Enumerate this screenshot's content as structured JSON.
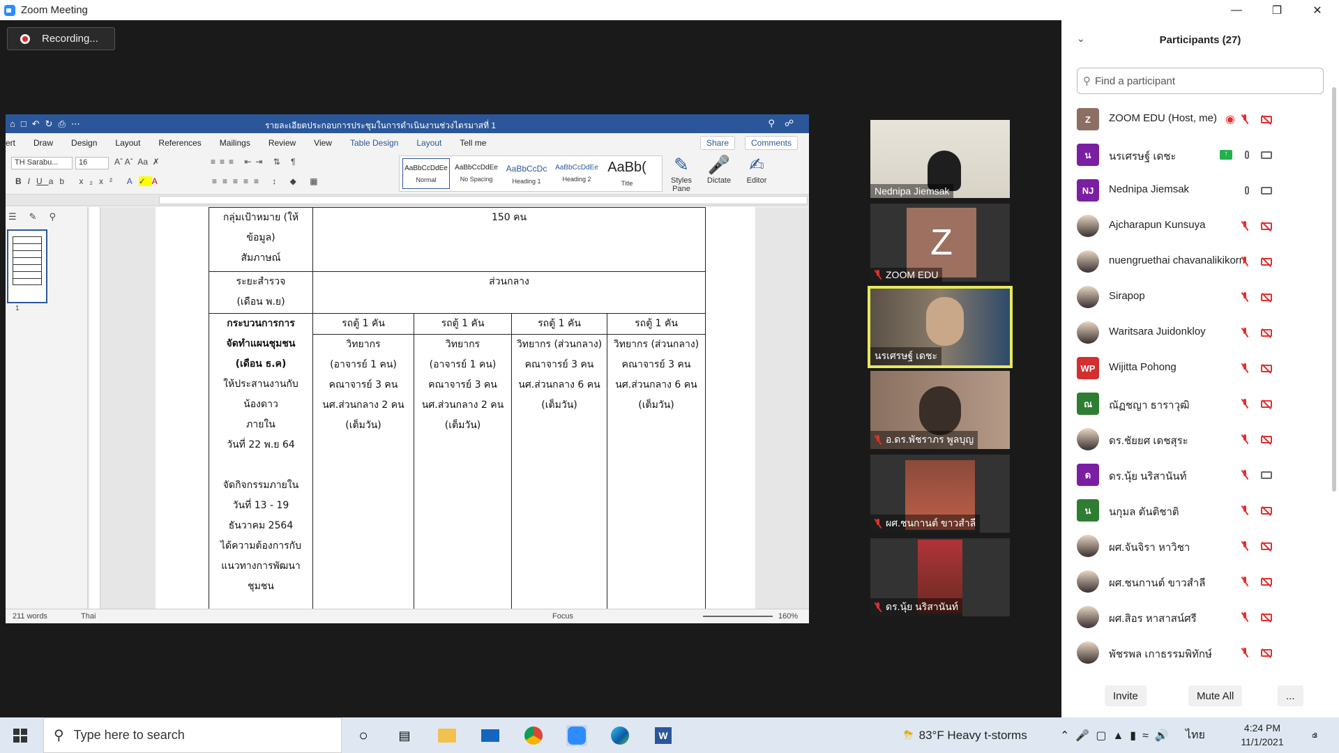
{
  "window": {
    "title": "Zoom Meeting"
  },
  "recording": {
    "label": "Recording..."
  },
  "word": {
    "doc_title": "รายละเอียดประกอบการประชุมในการดำเนินงานช่วงไตรมาสที่ 1",
    "menu": [
      "ert",
      "Draw",
      "Design",
      "Layout",
      "References",
      "Mailings",
      "Review",
      "View",
      "Table Design",
      "Layout",
      "Tell me"
    ],
    "share_label": "Share",
    "comments_label": "Comments",
    "font_name": "TH Sarabu...",
    "font_size": "16",
    "styles": [
      {
        "preview": "AaBbCcDdEe",
        "name": "Normal"
      },
      {
        "preview": "AaBbCcDdEe",
        "name": "No Spacing"
      },
      {
        "preview": "AaBbCcDc",
        "name": "Heading 1"
      },
      {
        "preview": "AaBbCcDdEe",
        "name": "Heading 2"
      },
      {
        "preview": "AaBb(",
        "name": "Title"
      }
    ],
    "styles_pane": "Styles Pane",
    "dictate": "Dictate",
    "editor": "Editor",
    "thumb_page": "1",
    "status": {
      "words": "211 words",
      "lang": "Thai",
      "focus": "Focus",
      "zoom": "160%"
    }
  },
  "table": {
    "r1_label": [
      "กลุ่มเป้าหมาย (ให้",
      "ข้อมูล)",
      "สัมภาษณ์"
    ],
    "r1_value": "150 คน",
    "r2_label": [
      "ระยะสำรวจ",
      "(เดือน พ.ย)"
    ],
    "r2_value": "ส่วนกลาง",
    "r3_label": [
      "กระบวนการการ",
      "จัดทำแผนชุมชน",
      "(เดือน ธ.ค)"
    ],
    "r3_head": [
      "รถตู้ 1 คัน",
      "รถตู้ 1 คัน",
      "รถตู้ 1 คัน",
      "รถตู้ 1 คัน"
    ],
    "r4_label": [
      "ให้ประสานงานกับ",
      "น้องดาว",
      "ภายใน",
      "วันที่ 22 พ.ย 64",
      "",
      "จัดกิจกรรมภายใน",
      "วันที่ 13 - 19",
      "ธันวาคม 2564",
      "ได้ความต้องการกับ",
      "แนวทางการพัฒนา",
      "ชุมชน"
    ],
    "c1": [
      "วิทยากร",
      "(อาจารย์ 1 คน)",
      "คณาจารย์ 3 คน",
      "นศ.ส่วนกลาง 2 คน",
      "(เต็มวัน)"
    ],
    "c2": [
      "วิทยากร",
      "(อาจารย์ 1 คน)",
      "คณาจารย์ 3 คน",
      "นศ.ส่วนกลาง 2 คน",
      "(เต็มวัน)"
    ],
    "c3": [
      "วิทยากร (ส่วนกลาง)",
      "คณาจารย์ 3 คน",
      "นศ.ส่วนกลาง 6 คน",
      "(เต็มวัน)"
    ],
    "c4": [
      "วิทยากร (ส่วนกลาง)",
      "คณาจารย์ 3 คน",
      "นศ.ส่วนกลาง 6 คน",
      "(เต็มวัน)"
    ]
  },
  "videos": [
    {
      "name": "Nednipa Jiemsak",
      "muted": false
    },
    {
      "name": "ZOOM EDU",
      "muted": true,
      "letter": "Z"
    },
    {
      "name": "นรเศรษฐ์ เดชะ",
      "muted": false,
      "active": true
    },
    {
      "name": "อ.ดร.พัชราภร พูลบุญ",
      "muted": true
    },
    {
      "name": "ผศ.ชนกานต์ ขาวสำลี",
      "muted": true
    },
    {
      "name": "ดร.นุ้ย นริสานันท์",
      "muted": true
    }
  ],
  "participants": {
    "title": "Participants (27)",
    "search_placeholder": "Find a participant",
    "list": [
      {
        "name": "ZOOM EDU (Host, me)",
        "initial": "Z",
        "color": "#8d6e63",
        "rec": true
      },
      {
        "name": "นรเศรษฐ์ เดชะ",
        "initial": "น",
        "color": "#7b1fa2",
        "share": true,
        "mic_on": true
      },
      {
        "name": "Nednipa Jiemsak",
        "initial": "NJ",
        "color": "#7b1fa2",
        "mic_on": true
      },
      {
        "name": "Ajcharapun Kunsuya",
        "photo": true
      },
      {
        "name": "nuengruethai chavanalikikorn",
        "photo": true
      },
      {
        "name": "Sirapop",
        "photo": true
      },
      {
        "name": "Waritsara Juidonkloy",
        "photo": true
      },
      {
        "name": "Wijitta Pohong",
        "initial": "WP",
        "color": "#d32f2f"
      },
      {
        "name": "ณัฏชญา ธาราวุฒิ",
        "initial": "ณ",
        "color": "#2e7d32"
      },
      {
        "name": "ดร.ชัยยศ เดชสุระ",
        "photo": true
      },
      {
        "name": "ดร.นุ้ย นริสานันท์",
        "initial": "ด",
        "color": "#7b1fa2",
        "video_on": true
      },
      {
        "name": "นกุมล ตันติชาติ",
        "initial": "น",
        "color": "#2e7d32"
      },
      {
        "name": "ผศ.จันจิรา หาวิชา",
        "photo": true
      },
      {
        "name": "ผศ.ชนกานต์ ขาวสำลี",
        "photo": true
      },
      {
        "name": "ผศ.สิอร หาสาสน์ศรี",
        "photo": true
      },
      {
        "name": "พัชรพล เกาธรรมพิทักษ์",
        "photo": true
      }
    ],
    "invite": "Invite",
    "mute_all": "Mute All",
    "more": "..."
  },
  "taskbar": {
    "search": "Type here to search",
    "weather": "83°F  Heavy t-storms",
    "lang": "ไทย",
    "time": "4:24 PM",
    "date": "11/1/2021",
    "notif": "3"
  }
}
